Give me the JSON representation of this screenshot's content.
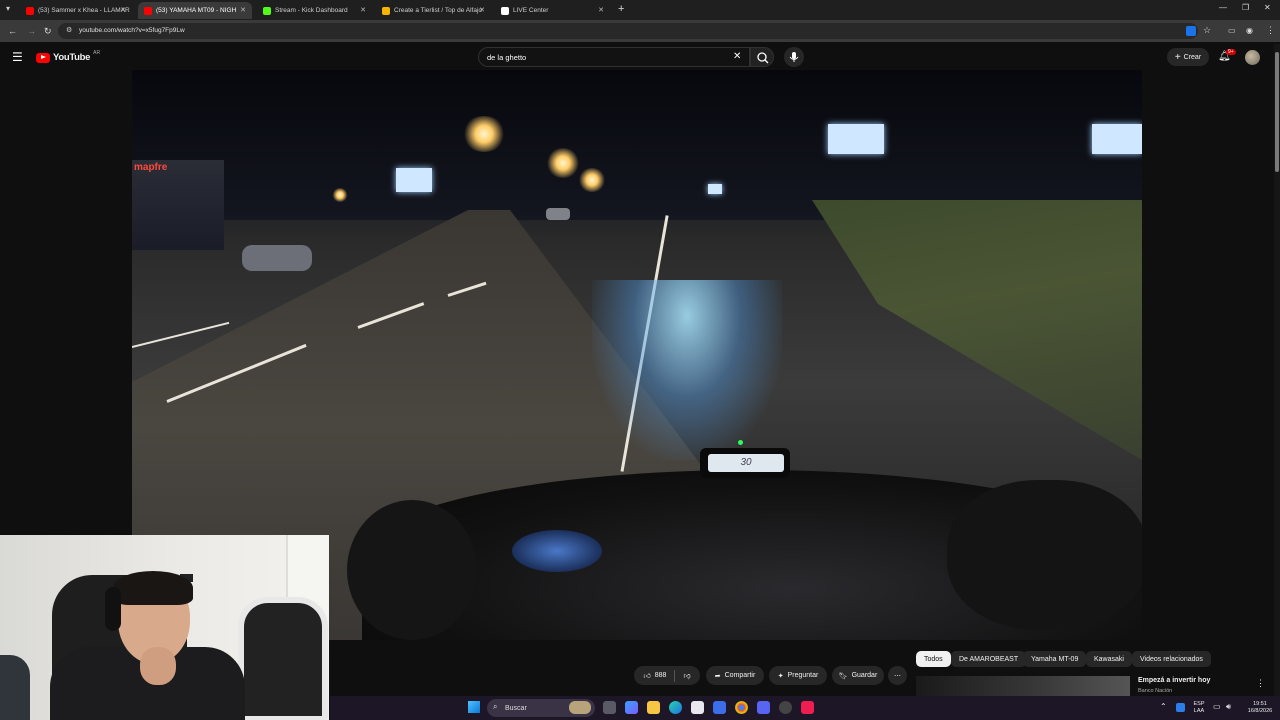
{
  "browser": {
    "tabs": [
      {
        "title": "(53) Sammer x Khea - LLAMAR",
        "favicon_color": "#ff0000",
        "active": false
      },
      {
        "title": "(53) YAMAHA MT09 - NIGH",
        "favicon_color": "#ff0000",
        "active": true
      },
      {
        "title": "Stream - Kick Dashboard",
        "favicon_color": "#53fc18",
        "active": false
      },
      {
        "title": "Create a Tierlist / Top de Alfajo",
        "favicon_color": "#f4b400",
        "active": false
      },
      {
        "title": "LIVE Center",
        "favicon_color": "#ffffff",
        "active": false
      }
    ],
    "url": "youtube.com/watch?v=x5fug7Fp9Lw"
  },
  "youtube": {
    "logo_text": "YouTube",
    "country_code": "AR",
    "search_value": "de la ghetto",
    "create_label": "Crear",
    "notification_count": "9+"
  },
  "actions": {
    "likes": "888",
    "share_label": "Compartir",
    "ask_label": "Preguntar",
    "save_label": "Guardar"
  },
  "chips": [
    "Todos",
    "De AMAROBEAST",
    "Yamaha MT-09",
    "Kawasaki",
    "Videos relacionados"
  ],
  "ad": {
    "title": "Empezá a invertir hoy",
    "advertiser": "Banco Nación"
  },
  "video_overlay": {
    "sign_text": "mapfre",
    "speedometer": "30"
  },
  "taskbar": {
    "search_placeholder": "Buscar",
    "language": "ESP",
    "layout": "LAA",
    "time": "19:51",
    "date": "16/8/2026"
  },
  "colors": {
    "yt_red": "#ff0000",
    "bg": "#0f0f0f",
    "chip_bg": "#272727",
    "taskbar": "#1c1626"
  }
}
